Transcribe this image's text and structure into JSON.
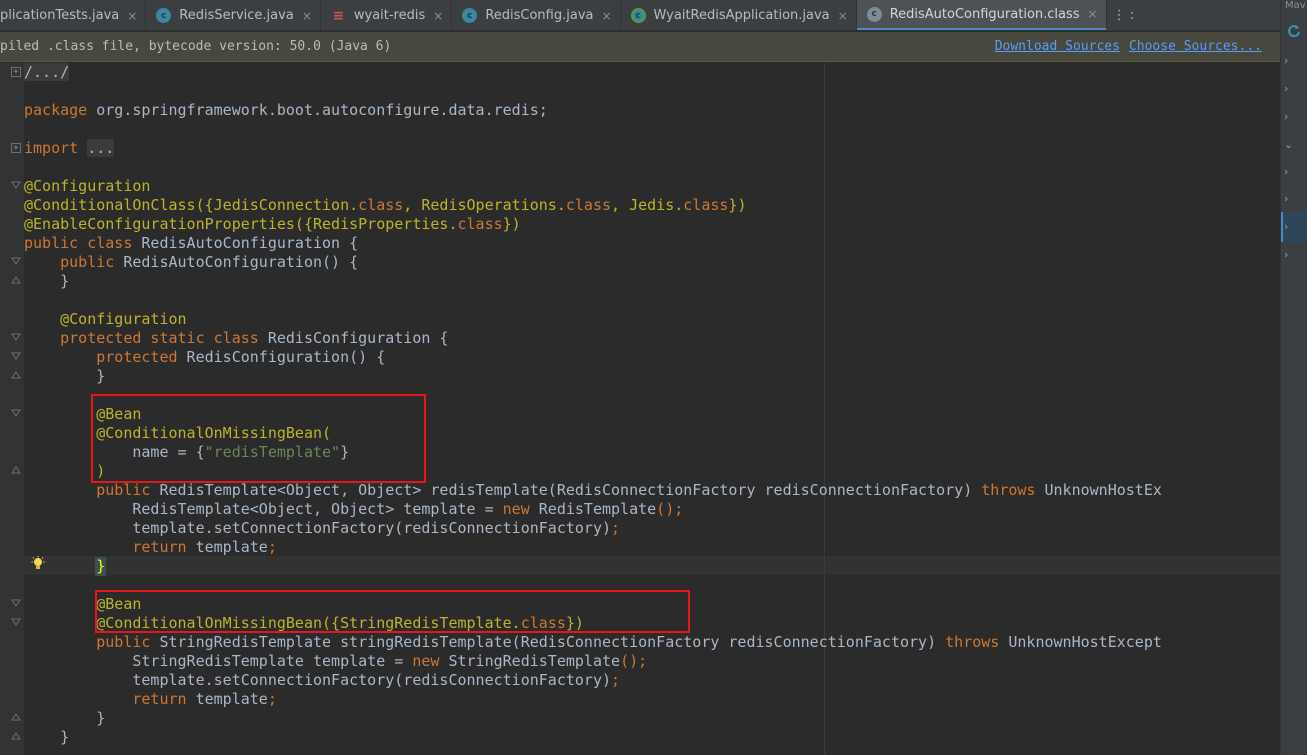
{
  "tabs": [
    {
      "label": "plicationTests.java",
      "icon": "class-icon",
      "active": false
    },
    {
      "label": "RedisService.java",
      "icon": "class-icon",
      "active": false
    },
    {
      "label": "wyait-redis",
      "icon": "maven-icon",
      "active": false
    },
    {
      "label": "RedisConfig.java",
      "icon": "class-icon",
      "active": false
    },
    {
      "label": "WyaitRedisApplication.java",
      "icon": "spring-app-icon",
      "active": false
    },
    {
      "label": "RedisAutoConfiguration.class",
      "icon": "compiled-class-icon",
      "active": true
    }
  ],
  "tab_overflow": "⋮ :",
  "close_glyph": "×",
  "notice": {
    "message": "piled .class file, bytecode version: 50.0 (Java 6)",
    "download_sources": "Download Sources",
    "choose_sources": "Choose Sources..."
  },
  "sidebar": {
    "label": "Mav"
  },
  "colors": {
    "editor_bg": "#2b2b2b",
    "keyword": "#cc7832",
    "annotation": "#bbb529",
    "string": "#6a8759",
    "text": "#a9b7c6",
    "highlight_box": "#e8161b"
  },
  "code": {
    "l0_fold": "/.../",
    "l2_kw": "package",
    "l2_rest": " org.springframework.boot.autoconfigure.data.redis;",
    "l4_kw": "import",
    "l4_fold": "...",
    "l6": "@Configuration",
    "l7_a": "@ConditionalOnClass({JedisConnection.",
    "l7_k1": "class",
    "l7_b": ", RedisOperations.",
    "l7_k2": "class",
    "l7_c": ", Jedis.",
    "l7_k3": "class",
    "l7_d": "})",
    "l8_a": "@EnableConfigurationProperties({RedisProperties.",
    "l8_k": "class",
    "l8_b": "})",
    "l9_kw": "public class",
    "l9_rest": " RedisAutoConfiguration {",
    "l10_kw": "public",
    "l10_rest": " RedisAutoConfiguration() {",
    "l11": "}",
    "l13": "@Configuration",
    "l14_kw": "protected static class",
    "l14_rest": " RedisConfiguration {",
    "l15_kw": "protected",
    "l15_rest": " RedisConfiguration() {",
    "l16": "}",
    "l18": "@Bean",
    "l19": "@ConditionalOnMissingBean(",
    "l20_a": "name = {",
    "l20_s": "\"redisTemplate\"",
    "l20_b": "}",
    "l21": ")",
    "l22_kw": "public",
    "l22_a": " RedisTemplate<Object, Object> redisTemplate(RedisConnectionFactory redisConnectionFactory) ",
    "l22_kw2": "throws",
    "l22_b": " UnknownHostEx",
    "l23_a": "RedisTemplate<Object, Object> template = ",
    "l23_kw": "new",
    "l23_b": " RedisTemplate",
    "l23_c": "();",
    "l24": "template.setConnectionFactory(redisConnectionFactory)",
    "l24_semi": ";",
    "l25_kw": "return",
    "l25_rest": " template",
    "l25_semi": ";",
    "l26": "}",
    "l28": "@Bean",
    "l29_a": "@ConditionalOnMissingBean({StringRedisTemplate.",
    "l29_k": "class",
    "l29_b": "})",
    "l30_kw": "public",
    "l30_a": " StringRedisTemplate stringRedisTemplate(RedisConnectionFactory redisConnectionFactory) ",
    "l30_kw2": "throws",
    "l30_b": " UnknownHostExcept",
    "l31_a": "StringRedisTemplate template = ",
    "l31_kw": "new",
    "l31_b": " StringRedisTemplate",
    "l31_c": "();",
    "l32": "template.setConnectionFactory(redisConnectionFactory)",
    "l32_semi": ";",
    "l33_kw": "return",
    "l33_rest": " template",
    "l33_semi": ";",
    "l34": "}",
    "l35": "}"
  }
}
